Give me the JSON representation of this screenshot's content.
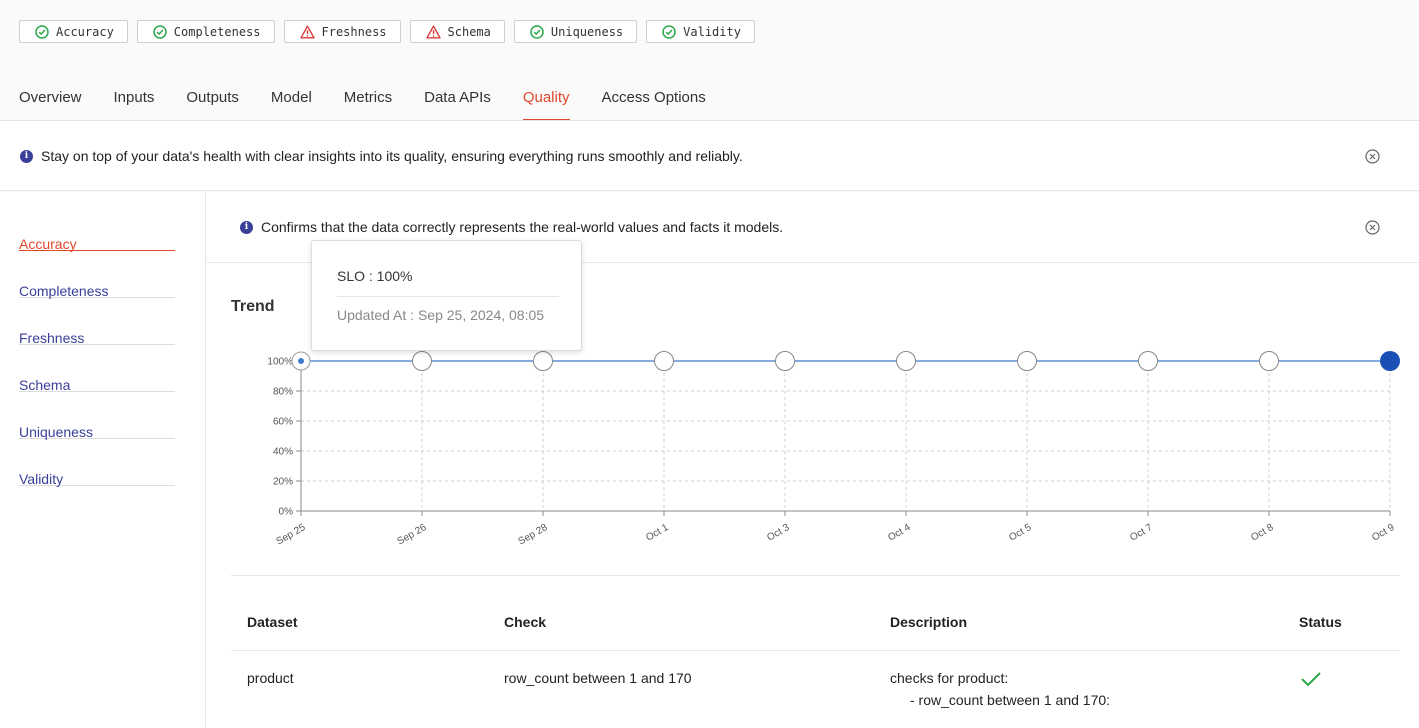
{
  "badges": [
    {
      "label": "Accuracy",
      "status": "pass"
    },
    {
      "label": "Completeness",
      "status": "pass"
    },
    {
      "label": "Freshness",
      "status": "warn"
    },
    {
      "label": "Schema",
      "status": "warn"
    },
    {
      "label": "Uniqueness",
      "status": "pass"
    },
    {
      "label": "Validity",
      "status": "pass"
    }
  ],
  "tabs": [
    "Overview",
    "Inputs",
    "Outputs",
    "Model",
    "Metrics",
    "Data APIs",
    "Quality",
    "Access Options"
  ],
  "active_tab": "Quality",
  "page_info": "Stay on top of your data's health with clear insights into its quality, ensuring everything runs smoothly and reliably.",
  "sidebar": {
    "items": [
      "Accuracy",
      "Completeness",
      "Freshness",
      "Schema",
      "Uniqueness",
      "Validity"
    ],
    "active": "Accuracy"
  },
  "section_info": "Confirms that the data correctly represents the real-world values and facts it models.",
  "trend_title": "Trend",
  "tooltip": {
    "slo": "SLO : 100%",
    "updated": "Updated At : Sep 25, 2024, 08:05"
  },
  "chart_data": {
    "type": "line",
    "categories": [
      "Sep 25",
      "Sep 26",
      "Sep 28",
      "Oct 1",
      "Oct 3",
      "Oct 4",
      "Oct 5",
      "Oct 7",
      "Oct 8",
      "Oct 9"
    ],
    "values": [
      100,
      100,
      100,
      100,
      100,
      100,
      100,
      100,
      100,
      100
    ],
    "y_ticks": [
      "0%",
      "20%",
      "40%",
      "60%",
      "80%",
      "100%"
    ],
    "ylim": [
      0,
      100
    ],
    "grid": true,
    "highlighted_point": 9,
    "line_color": "#5b8fd0",
    "point_active_color": "#1a4fb5"
  },
  "table": {
    "headers": [
      "Dataset",
      "Check",
      "Description",
      "Status"
    ],
    "rows": [
      {
        "dataset": "product",
        "check": "row_count between 1 and 170",
        "description_line1": "checks for product:",
        "description_line2": "- row_count between 1 and 170:",
        "status": "pass"
      }
    ]
  },
  "colors": {
    "accent": "#e0472b",
    "link": "#3a3f9a",
    "pass": "#2aa84a",
    "warn": "#d83a3a"
  }
}
